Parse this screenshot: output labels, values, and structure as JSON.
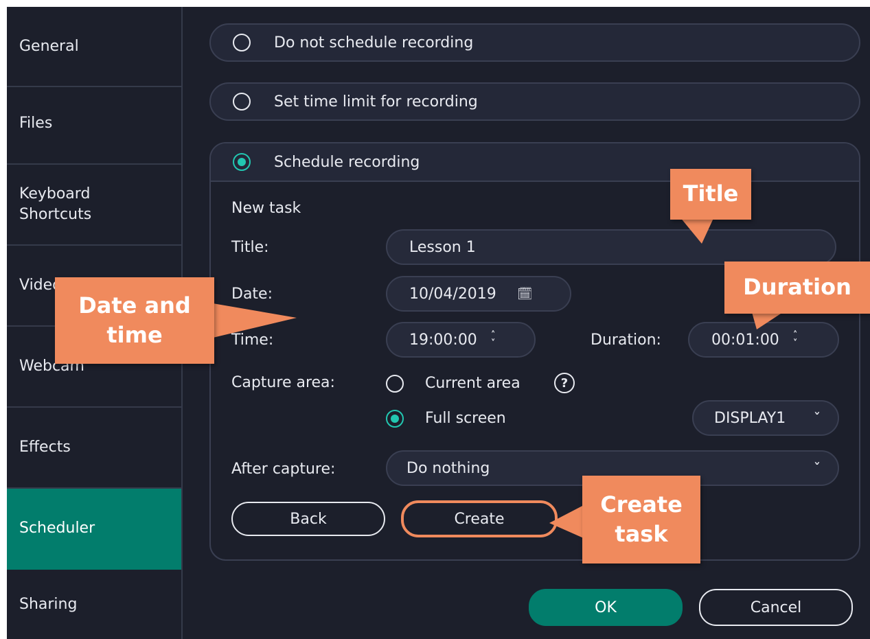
{
  "sidebar": {
    "items": [
      {
        "label": "General"
      },
      {
        "label": "Files"
      },
      {
        "label_line1": "Keyboard",
        "label_line2": "Shortcuts"
      },
      {
        "label": "Video"
      },
      {
        "label": "Webcam"
      },
      {
        "label": "Effects"
      },
      {
        "label": "Scheduler",
        "active": true
      },
      {
        "label": "Sharing"
      }
    ]
  },
  "options": {
    "no_schedule": "Do not schedule recording",
    "time_limit": "Set time limit for recording",
    "schedule": "Schedule recording",
    "selected": "schedule"
  },
  "task": {
    "heading": "New task",
    "title_label": "Title:",
    "title_value": "Lesson 1",
    "date_label": "Date:",
    "date_value": "10/04/2019",
    "time_label": "Time:",
    "time_value": "19:00:00",
    "duration_label": "Duration:",
    "duration_value": "00:01:00",
    "capture_label": "Capture area:",
    "capture_current": "Current area",
    "capture_full": "Full screen",
    "capture_selected": "full",
    "help_glyph": "?",
    "display_value": "DISPLAY1",
    "after_label": "After capture:",
    "after_value": "Do nothing",
    "back_button": "Back",
    "create_button": "Create"
  },
  "footer": {
    "ok_button": "OK",
    "cancel_button": "Cancel"
  },
  "callouts": {
    "title": "Title",
    "duration": "Duration",
    "date_time_line1": "Date and",
    "date_time_line2": "time",
    "create_line1": "Create",
    "create_line2": "task"
  },
  "icons": {
    "calendar": "calendar-icon",
    "spinner": "spinner-arrows-icon",
    "chevron": "chevron-down-icon",
    "help": "help-icon"
  },
  "colors": {
    "background": "#1c1f2b",
    "accent": "#027d6c",
    "radio_selected": "#22c7b1",
    "callout": "#f08a5d"
  }
}
